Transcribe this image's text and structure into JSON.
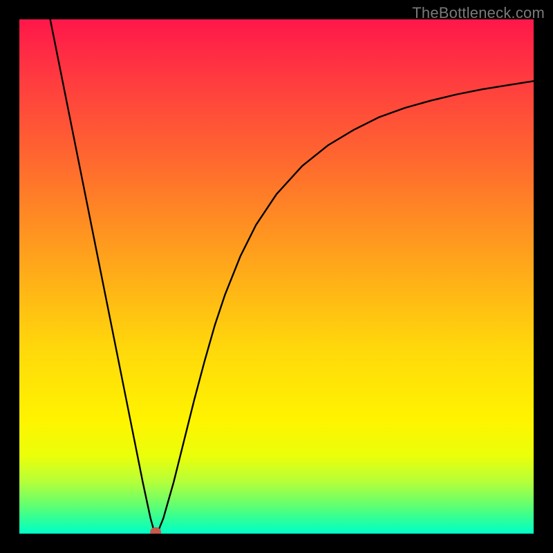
{
  "watermark": "TheBottleneck.com",
  "marker": {
    "x_frac": 0.265,
    "y_frac": 0.997,
    "color": "#c85a4a",
    "rx": 8,
    "ry": 7
  },
  "chart_data": {
    "type": "line",
    "title": "",
    "xlabel": "",
    "ylabel": "",
    "xlim": [
      0,
      1
    ],
    "ylim": [
      0,
      1
    ],
    "grid": false,
    "legend": false,
    "series": [
      {
        "name": "bottleneck-curve",
        "x": [
          0.06,
          0.08,
          0.1,
          0.12,
          0.14,
          0.16,
          0.18,
          0.2,
          0.22,
          0.24,
          0.255,
          0.262,
          0.27,
          0.28,
          0.3,
          0.32,
          0.34,
          0.36,
          0.38,
          0.4,
          0.43,
          0.46,
          0.5,
          0.55,
          0.6,
          0.65,
          0.7,
          0.75,
          0.8,
          0.85,
          0.9,
          0.95,
          1.0
        ],
        "y_top_down": [
          0.0,
          0.1,
          0.2,
          0.3,
          0.4,
          0.5,
          0.6,
          0.7,
          0.8,
          0.9,
          0.97,
          0.995,
          0.995,
          0.97,
          0.9,
          0.82,
          0.74,
          0.665,
          0.595,
          0.535,
          0.46,
          0.4,
          0.34,
          0.285,
          0.245,
          0.215,
          0.19,
          0.172,
          0.158,
          0.146,
          0.136,
          0.128,
          0.12
        ]
      }
    ],
    "marker_point": {
      "x": 0.265,
      "y_top_down": 0.997
    },
    "gradient_stops_top_to_bottom": [
      {
        "pos": 0.0,
        "color": "#ff174a"
      },
      {
        "pos": 0.12,
        "color": "#ff3c3f"
      },
      {
        "pos": 0.28,
        "color": "#ff6a2e"
      },
      {
        "pos": 0.4,
        "color": "#ff8f22"
      },
      {
        "pos": 0.52,
        "color": "#ffb416"
      },
      {
        "pos": 0.64,
        "color": "#ffd80b"
      },
      {
        "pos": 0.78,
        "color": "#fff400"
      },
      {
        "pos": 0.85,
        "color": "#eaff0a"
      },
      {
        "pos": 0.9,
        "color": "#b4ff3a"
      },
      {
        "pos": 0.94,
        "color": "#6bff6a"
      },
      {
        "pos": 0.97,
        "color": "#30ff97"
      },
      {
        "pos": 0.99,
        "color": "#10ffb8"
      },
      {
        "pos": 1.0,
        "color": "#00ffc9"
      }
    ]
  }
}
